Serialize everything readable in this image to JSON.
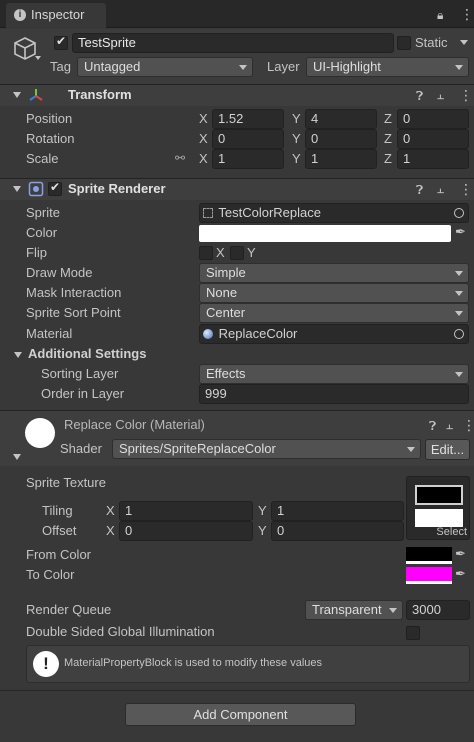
{
  "window": {
    "tab_title": "Inspector"
  },
  "gameobject": {
    "name": "TestSprite",
    "static_label": "Static",
    "tag_label": "Tag",
    "tag_value": "Untagged",
    "layer_label": "Layer",
    "layer_value": "UI-Highlight"
  },
  "transform": {
    "title": "Transform",
    "position_label": "Position",
    "rotation_label": "Rotation",
    "scale_label": "Scale",
    "axis_x": "X",
    "axis_y": "Y",
    "axis_z": "Z",
    "position": {
      "x": "1.52",
      "y": "4",
      "z": "0"
    },
    "rotation": {
      "x": "0",
      "y": "0",
      "z": "0"
    },
    "scale": {
      "x": "1",
      "y": "1",
      "z": "1"
    }
  },
  "sprite_renderer": {
    "title": "Sprite Renderer",
    "sprite_label": "Sprite",
    "sprite_value": "TestColorReplace",
    "color_label": "Color",
    "color_value": "#ffffff",
    "flip_label": "Flip",
    "flip_x": "X",
    "flip_y": "Y",
    "draw_mode_label": "Draw Mode",
    "draw_mode_value": "Simple",
    "mask_label": "Mask Interaction",
    "mask_value": "None",
    "sort_point_label": "Sprite Sort Point",
    "sort_point_value": "Center",
    "material_label": "Material",
    "material_value": "ReplaceColor",
    "additional_label": "Additional Settings",
    "sorting_layer_label": "Sorting Layer",
    "sorting_layer_value": "Effects",
    "order_label": "Order in Layer",
    "order_value": "999"
  },
  "material": {
    "title": "Replace Color (Material)",
    "shader_label": "Shader",
    "shader_value": "Sprites/SpriteReplaceColor",
    "edit_label": "Edit...",
    "texture_label": "Sprite Texture",
    "tiling_label": "Tiling",
    "offset_label": "Offset",
    "axis_x": "X",
    "axis_y": "Y",
    "tiling": {
      "x": "1",
      "y": "1"
    },
    "offset": {
      "x": "0",
      "y": "0"
    },
    "select_label": "Select",
    "from_color_label": "From Color",
    "from_color_value": "#000000",
    "to_color_label": "To Color",
    "to_color_value": "#ff00ff",
    "render_queue_label": "Render Queue",
    "render_queue_mode": "Transparent",
    "render_queue_value": "3000",
    "gi_label": "Double Sided Global Illumination",
    "info_message": "MaterialPropertyBlock is used to modify these values"
  },
  "footer": {
    "add_component_label": "Add Component"
  }
}
